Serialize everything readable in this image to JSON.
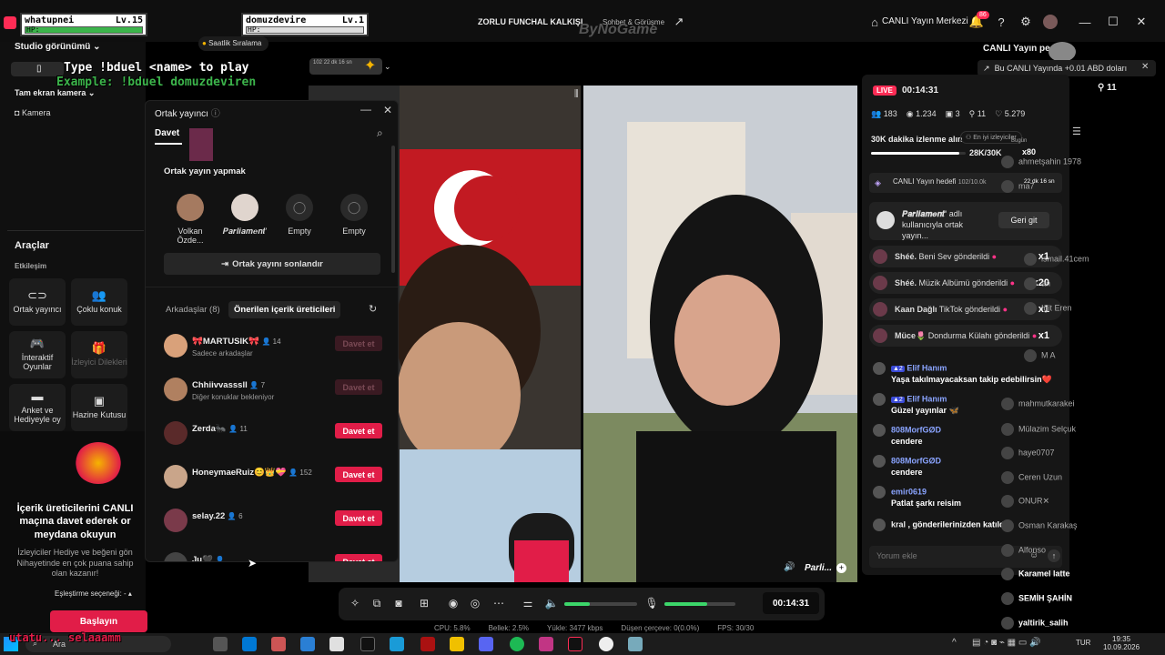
{
  "hp_boxes": [
    {
      "name": "whatupnei",
      "level": "Lv.15",
      "hp_label": "HP:",
      "hp": 1.0
    },
    {
      "name": "domuzdevire",
      "level": "Lv.1",
      "hp_label": "HP:",
      "hp": 0.0
    }
  ],
  "header": {
    "stream_title": "ZORLU FUNCHAL KALKIŞI",
    "category": "Sohbet & Görüşme",
    "watermark": "ByNoGame",
    "live_center": "CANLI Yayın Merkezi",
    "notif_count": "86"
  },
  "overlay": {
    "line1": "Type !bduel <name> to play",
    "line2": "Example: !bduel domuzdeviren"
  },
  "left": {
    "studio_view": "Studio görünümü",
    "hourly_rank": "Saatlik Sıralama",
    "fullscreen_camera": "Tam ekran kamera",
    "camera": "Kamera",
    "tools": "Araçlar",
    "interaction": "Etkileşim",
    "tool_items": [
      {
        "label": "Ortak yayıncı",
        "icon": "link-icon"
      },
      {
        "label": "Çoklu konuk",
        "icon": "users-icon"
      },
      {
        "label": "İnteraktif Oyunlar",
        "icon": "gamepad-icon"
      },
      {
        "label": "İzleyici Dilekleri",
        "icon": "gift-icon"
      },
      {
        "label": "Anket ve Hediyeyle oy",
        "icon": "poll-icon"
      },
      {
        "label": "Hazine Kutusu",
        "icon": "chest-icon"
      }
    ],
    "promo_title": "İçerik üreticilerini CANLI maçına davet ederek or meydana okuyun",
    "promo_desc": "İzleyiciler Hediye ve beğeni gön Nihayetinde en çok puana sahip olan kazanır!",
    "matching": "Eşleştirme seçeneği: -",
    "start": "Başlayın",
    "bottom_names": "utatu... selaaamm"
  },
  "modal": {
    "title": "Ortak yayıncı",
    "tab_invite": "Davet",
    "section": "Ortak yayın yapmak",
    "cohosts": [
      {
        "name": "Volkan Özde...",
        "empty": false
      },
      {
        "name": "𝑷𝒂𝒓𝒍𝒊𝒂𝒎𝒆𝒏𝒕'",
        "empty": false
      },
      {
        "name": "Empty",
        "empty": true
      },
      {
        "name": "Empty",
        "empty": true
      }
    ],
    "end_button": "Ortak yayını sonlandır",
    "tab_friends": "Arkadaşlar (8)",
    "tab_suggested": "Önerilen içerik üreticileri",
    "friends": [
      {
        "name": "🎀MARTUSIK🎀",
        "count": "14",
        "sub": "Sadece arkadaşlar",
        "btn": "Davet et",
        "enabled": false,
        "color": "#d9a17a"
      },
      {
        "name": "Chhiivvasssll",
        "count": "7",
        "sub": "Diğer konuklar bekleniyor",
        "btn": "Davet et",
        "enabled": false,
        "color": "#b08060"
      },
      {
        "name": "Zerda🐜",
        "count": "11",
        "sub": "",
        "btn": "Davet et",
        "enabled": true,
        "color": "#5a2a2a"
      },
      {
        "name": "HoneymaeRuiz😊👑💝",
        "count": "152",
        "sub": "",
        "btn": "Davet et",
        "enabled": true,
        "color": "#c9a58a"
      },
      {
        "name": "selay.22",
        "count": "6",
        "sub": "",
        "btn": "Davet et",
        "enabled": true,
        "color": "#7a3a4a"
      },
      {
        "name": "Ju🖤",
        "count": "",
        "sub": "",
        "btn": "Davet et",
        "enabled": true,
        "color": "#444"
      }
    ]
  },
  "video": {
    "right_name": "Parli...",
    "duel_meta": "22 dk 16 sn",
    "top_count": "102"
  },
  "controls": {
    "timer": "00:14:31",
    "volume": 0.35,
    "mic": 0.6
  },
  "stats": {
    "cpu": "CPU: 5.8%",
    "memory": "Bellek: 2.5%",
    "upload": "Yükle: 3477 kbps",
    "dropped": "Düşen çerçeve: 0(0.0%)",
    "fps": "FPS: 30/30"
  },
  "chat": {
    "live": "LIVE",
    "time": "00:14:31",
    "viewers": "183",
    "likes_top": "11",
    "stats": [
      "183",
      "1.234",
      "3",
      "11",
      "5.279"
    ],
    "goal_title": "30K dakika izlenme alın",
    "goal_value": "28K/30K",
    "goal_progress": 0.93,
    "target": "CANLI Yayın hedefi",
    "target_value": "102/10.0k",
    "target_time": "22 dk 16 sn",
    "join_msg_name": "𝑷𝒂𝒓𝒍𝒊𝒂𝒎𝒆𝒏𝒕'",
    "join_msg": "adlı kullanıcıyla ortak yayın...",
    "back": "Geri git",
    "gifts": [
      {
        "user": "Shéé.",
        "text": "Beni Sev gönderildi",
        "count": "x1"
      },
      {
        "user": "Shéé.",
        "text": "Müzik Albümü gönderildi",
        "count": "x20"
      },
      {
        "user": "Kaan Dağlı",
        "text": "TikTok gönderildi",
        "count": "x1"
      },
      {
        "user": "Müce🌷",
        "text": "Dondurma Külahı gönderildi",
        "count": "x1"
      }
    ],
    "messages": [
      {
        "user": "Elif Hanım",
        "text": "Yaşa takılmayacaksan takip edebilirsin❤️"
      },
      {
        "user": "Elif Hanım",
        "text": "Güzel yayınlar 🦋"
      },
      {
        "user": "808MorfGØD",
        "text": "cendere"
      },
      {
        "user": "808MorfGØD",
        "text": "cendere"
      },
      {
        "user": "emir0619",
        "text": "Patlat şarkı reisim"
      },
      {
        "user": "kral",
        "text": ", gönderilerinizden katıldı"
      }
    ],
    "input_placeholder": "Yorum ekle"
  },
  "right_top": {
    "live_partner": "CANLI Yayın pe",
    "earn": "Bu CANLI Yayında +0.01 ABD doları",
    "top_viewers_btn": "En iyi izleyiciler",
    "today": "Bugün",
    "x80": "x80",
    "stats_right": [
      "183",
      "11"
    ]
  },
  "viewers": [
    "ahmetşahin 1978",
    "ma7",
    "ismail.41cem",
    "an",
    "Iğit Eren",
    "M A",
    "mahmutkarakei",
    "Mülazim Selçuk",
    "haye0707",
    "Ceren Uzun",
    "ONUR✕",
    "Osman Karakaş",
    "Alfonso",
    "Karamel latte",
    "SEMİH ŞAHİN",
    "yaltirik_salih"
  ],
  "taskbar": {
    "search": "Ara",
    "lang": "TUR",
    "clock": "19:35",
    "date": "10.09.2026"
  },
  "colors": {
    "accent": "#e11d48",
    "hp_green": "#3cb44b"
  }
}
